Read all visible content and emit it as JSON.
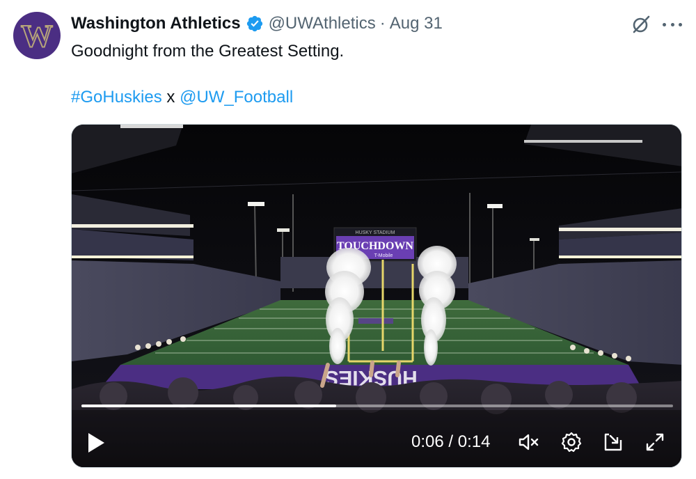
{
  "tweet": {
    "avatar_letter": "W",
    "display_name": "Washington Athletics",
    "handle": "@UWAthletics",
    "separator": "·",
    "date": "Aug 31",
    "text": "Goodnight from the Greatest Setting.",
    "hashtag": "#GoHuskies",
    "connector": "x",
    "mention": "@UW_Football"
  },
  "video": {
    "scoreboard_header": "HUSKY STADIUM",
    "scoreboard_text": "TOUCHDOWN",
    "scoreboard_sponsor": "T-Mobile",
    "endzone_text": "HUSKIES",
    "time_current": "0:06",
    "time_divider": "/",
    "time_total": "0:14",
    "progress": 0.43
  },
  "icons": {
    "verified": "verified-badge-icon",
    "grok": "grok-icon",
    "more": "more-icon",
    "play": "play-icon",
    "mute": "muted-speaker-icon",
    "settings": "gear-icon",
    "pip": "picture-in-picture-icon",
    "fullscreen": "fullscreen-icon"
  },
  "colors": {
    "brand_purple": "#4b2e83",
    "brand_gold": "#b7a57a",
    "link_blue": "#1d9bf0",
    "secondary_text": "#536471"
  }
}
